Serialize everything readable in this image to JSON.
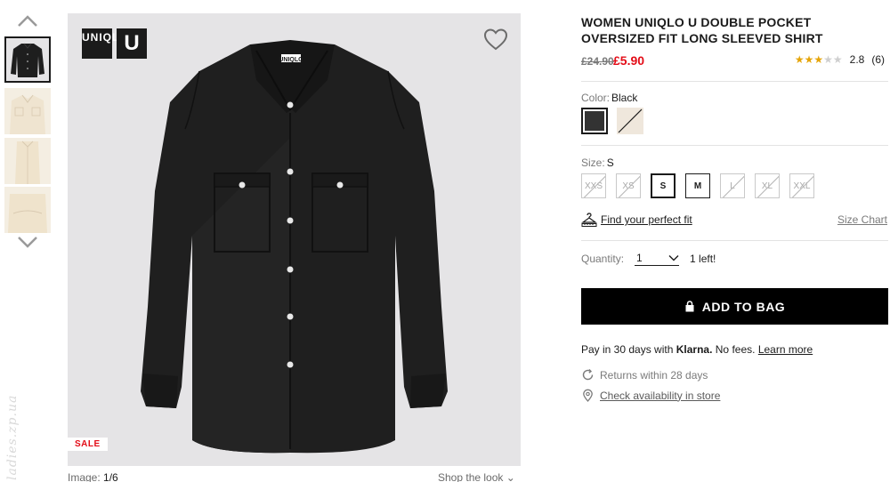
{
  "gallery": {
    "thumbnails": [
      {
        "name": "black"
      },
      {
        "name": "cream-1"
      },
      {
        "name": "cream-2"
      },
      {
        "name": "cream-3"
      }
    ],
    "up_icon": "chevron-up-icon",
    "down_icon": "chevron-down-icon"
  },
  "main_image": {
    "logo_top": "UNI",
    "logo_bottom": "QLO",
    "logo_u": "U",
    "sale_badge": "SALE",
    "shirt_color": "#1e1e1e"
  },
  "image_counter": {
    "label": "Image:",
    "value": "1/6"
  },
  "shop_the_look": "Shop the look ⌄",
  "watermark": "ladies.zp.ua",
  "product": {
    "title": "WOMEN UNIQLO U DOUBLE POCKET OVERSIZED FIT LONG SLEEVED SHIRT",
    "old_price": "£24.90",
    "new_price": "£5.90",
    "rating": {
      "stars_filled": 3,
      "stars_total": 5,
      "value": "2.8",
      "count": "(6)"
    }
  },
  "color": {
    "label": "Color:",
    "selected": "Black",
    "swatches": [
      {
        "name": "Black",
        "hex": "#333333"
      },
      {
        "name": "Cream",
        "hex": "#efe7dc"
      }
    ]
  },
  "size": {
    "label": "Size:",
    "selected": "S",
    "options": [
      {
        "label": "XXS",
        "state": "unavailable"
      },
      {
        "label": "XS",
        "state": "unavailable"
      },
      {
        "label": "S",
        "state": "selected"
      },
      {
        "label": "M",
        "state": "available"
      },
      {
        "label": "L",
        "state": "unavailable"
      },
      {
        "label": "XL",
        "state": "unavailable"
      },
      {
        "label": "XXL",
        "state": "unavailable"
      }
    ],
    "fit_link": "Find your perfect fit",
    "size_chart": "Size Chart"
  },
  "quantity": {
    "label": "Quantity:",
    "value": "1",
    "stock_note": "1 left!"
  },
  "add_to_bag": "ADD TO BAG",
  "klarna": {
    "prefix": "Pay in 30 days with",
    "brand": "Klarna.",
    "middle": "No fees.",
    "link": "Learn more"
  },
  "returns": "Returns within 28 days",
  "store_check": "Check availability in store",
  "colors": {
    "sale_red": "#e30c17",
    "star_gold": "#e5a50a",
    "button_black": "#000000"
  }
}
